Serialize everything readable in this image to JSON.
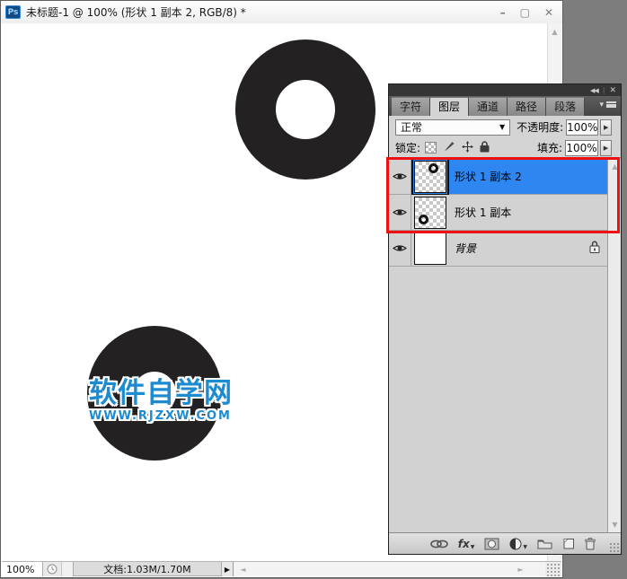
{
  "window": {
    "app_icon_label": "Ps",
    "title": "未标题-1 @ 100% (形状 1 副本 2, RGB/8) *",
    "minimize": "–",
    "maximize": "▢",
    "close": "✕"
  },
  "canvas": {
    "watermark_title": "软件自学网",
    "watermark_url": "WWW.RJZXW.COM",
    "watermark_color": "#1e8bd1",
    "shape_color": "#242122"
  },
  "statusbar": {
    "zoom_value": "100%",
    "doc_label": "文档:1.03M/1.70M"
  },
  "panel": {
    "collapse_icon": "◀◀",
    "close_icon": "✕",
    "tabs": [
      {
        "label": "字符"
      },
      {
        "label": "图层"
      },
      {
        "label": "通道"
      },
      {
        "label": "路径"
      },
      {
        "label": "段落"
      }
    ],
    "active_tab": "图层",
    "blend_mode": "正常",
    "opacity_label": "不透明度:",
    "opacity_value": "100%",
    "lock_label": "锁定:",
    "fill_label": "填充:",
    "fill_value": "100%",
    "layers": [
      {
        "name": "形状 1 副本 2",
        "selected": true
      },
      {
        "name": "形状 1 副本",
        "selected": false
      },
      {
        "name": "背景",
        "selected": false,
        "locked": true
      }
    ],
    "fx_label": "fx",
    "selection_color": "#2e86f0",
    "annotation_color": "#ee1111"
  }
}
